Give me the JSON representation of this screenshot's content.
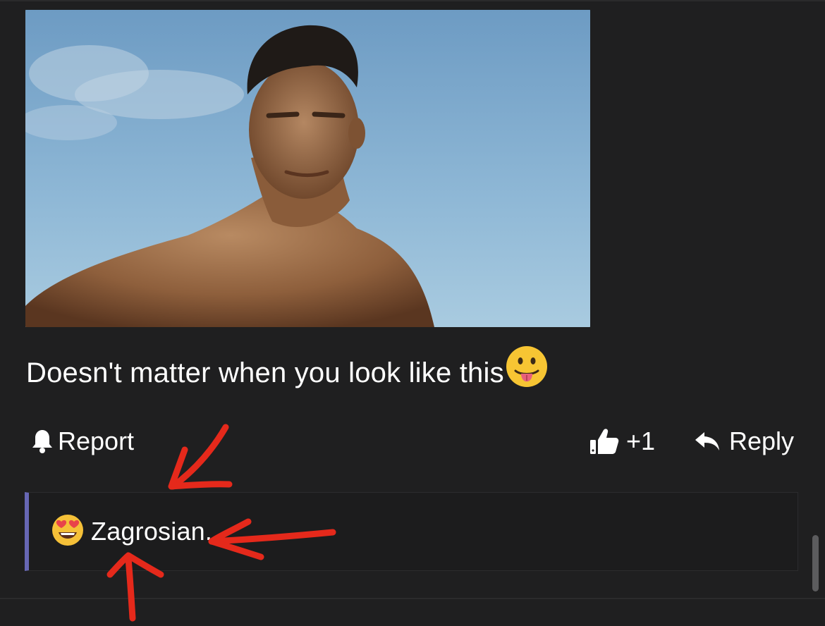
{
  "post": {
    "message": "Doesn't matter when you look like this",
    "message_emoji": "face-with-tongue-icon",
    "image": "photo of a man against a blue sky"
  },
  "actions": {
    "report_label": "Report",
    "like_label": "+1",
    "reply_label": "Reply"
  },
  "reactions": {
    "emoji": "smiling-face-with-heart-eyes-icon",
    "user": "Zagrosian."
  },
  "colors": {
    "background": "#1f1f20",
    "reaction_accent": "#6767b4",
    "annotation": "#e5291b",
    "text": "#ffffff"
  }
}
